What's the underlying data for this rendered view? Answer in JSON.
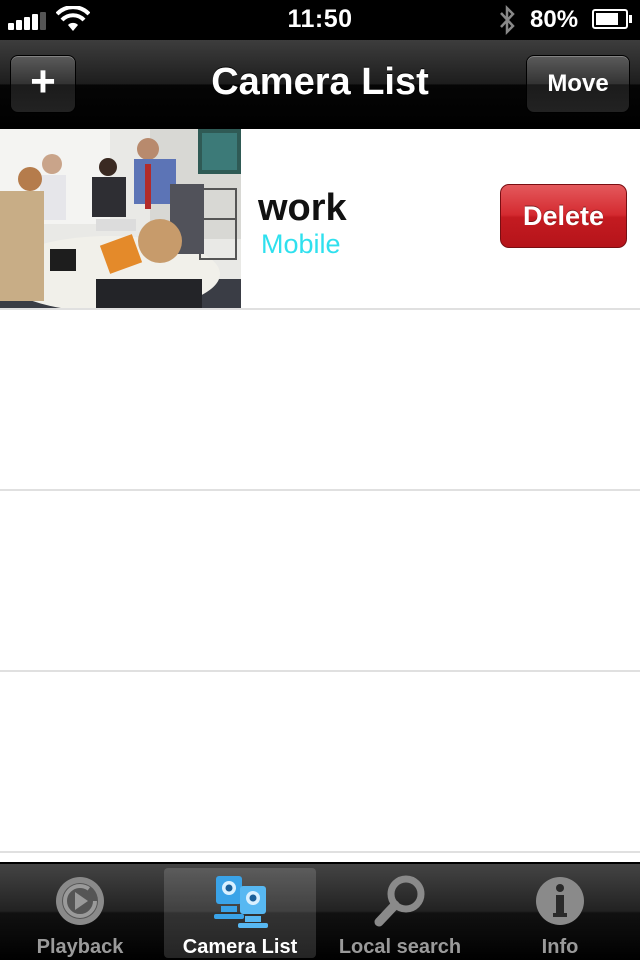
{
  "status_bar": {
    "time": "11:50",
    "battery_percent": "80%",
    "battery_level": 0.8
  },
  "nav_bar": {
    "title": "Camera List",
    "add_label": "+",
    "move_label": "Move"
  },
  "cameras": [
    {
      "name": "work",
      "type": "Mobile",
      "delete_label": "Delete"
    }
  ],
  "tabs": [
    {
      "label": "Playback",
      "icon": "playback-icon",
      "selected": false
    },
    {
      "label": "Camera List",
      "icon": "camera-list-icon",
      "selected": true
    },
    {
      "label": "Local search",
      "icon": "search-icon",
      "selected": false
    },
    {
      "label": "Info",
      "icon": "info-icon",
      "selected": false
    }
  ],
  "colors": {
    "type_text": "#2fe0ee",
    "delete_button": "#d42a30",
    "tab_selected_icon": "#3aa3e8"
  }
}
